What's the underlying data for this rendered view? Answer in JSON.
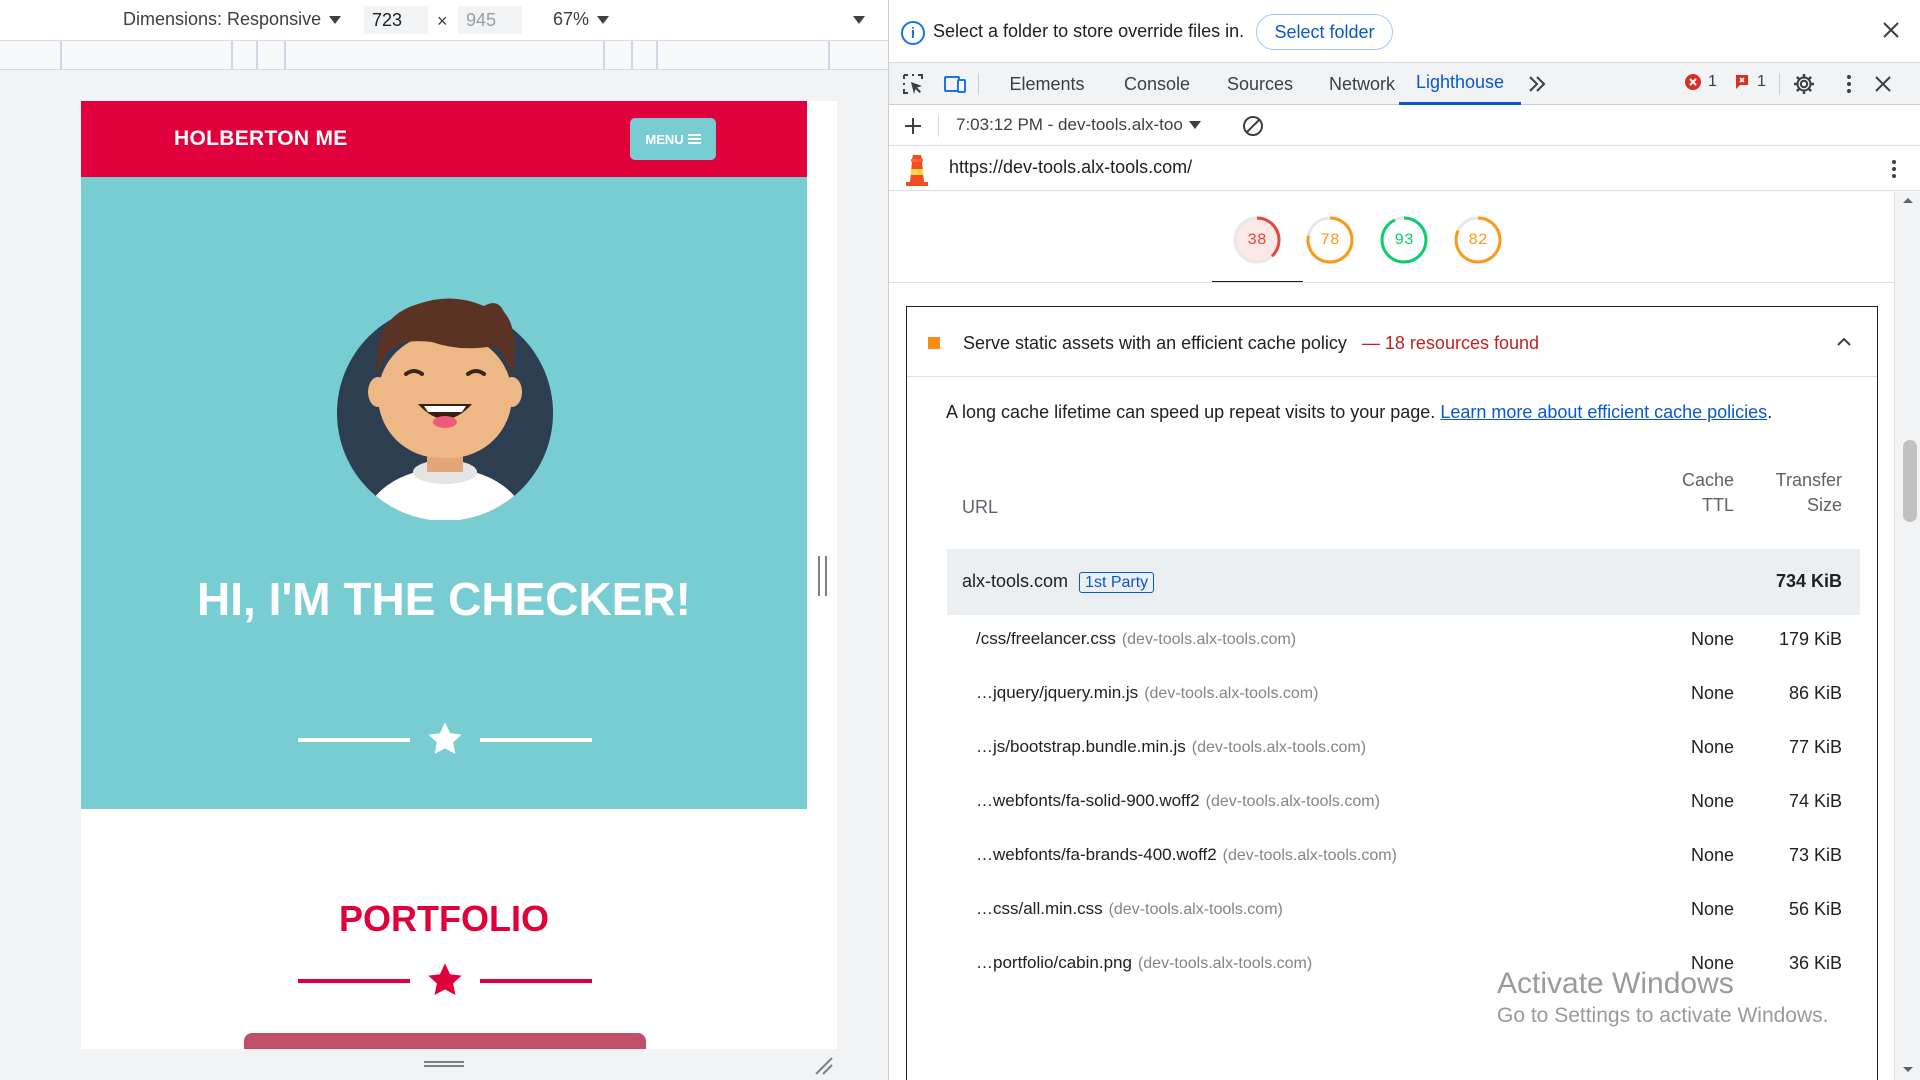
{
  "device_toolbar": {
    "dimensions_label": "Dimensions: Responsive",
    "width": "723",
    "times": "×",
    "height": "945",
    "zoom": "67%"
  },
  "site": {
    "brand": "HOLBERTON ME",
    "menu_label": "MENU",
    "hero_title": "HI, I'M THE CHECKER!",
    "portfolio_title": "PORTFOLIO",
    "colors": {
      "primary": "#e0003c",
      "teal": "#78cdd3"
    }
  },
  "infobar": {
    "message": "Select a folder to store override files in.",
    "button": "Select folder"
  },
  "tabs": [
    "Elements",
    "Console",
    "Sources",
    "Network",
    "Lighthouse"
  ],
  "active_tab": "Lighthouse",
  "issues": {
    "errors": "1",
    "warnings": "1"
  },
  "lighthouse": {
    "report_select": "7:03:12 PM - dev-tools.alx-too",
    "url": "https://dev-tools.alx-tools.com/",
    "scores": [
      {
        "value": 38,
        "color": "#e8453c",
        "bg": "#fce8e6"
      },
      {
        "value": 78,
        "color": "#fa9a1b",
        "bg": "#fff"
      },
      {
        "value": 93,
        "color": "#0cce6b",
        "bg": "#fff"
      },
      {
        "value": 82,
        "color": "#fa9a1b",
        "bg": "#fff"
      }
    ],
    "audit": {
      "title": "Serve static assets with an efficient cache policy",
      "dash": "—",
      "summary": "18 resources found",
      "description": "A long cache lifetime can speed up repeat visits to your page.",
      "learn_more": "Learn more about efficient cache policies",
      "period": ".",
      "table": {
        "headers": {
          "url": "URL",
          "ttl_1": "Cache",
          "ttl_2": "TTL",
          "size_1": "Transfer",
          "size_2": "Size"
        },
        "group": {
          "domain": "alx-tools.com",
          "tag": "1st Party",
          "size": "734 KiB"
        },
        "rows": [
          {
            "path": "/css/freelancer.css",
            "host": "(dev-tools.alx-tools.com)",
            "ttl": "None",
            "size": "179 KiB"
          },
          {
            "path": "…jquery/jquery.min.js",
            "host": "(dev-tools.alx-tools.com)",
            "ttl": "None",
            "size": "86 KiB"
          },
          {
            "path": "…js/bootstrap.bundle.min.js",
            "host": "(dev-tools.alx-tools.com)",
            "ttl": "None",
            "size": "77 KiB"
          },
          {
            "path": "…webfonts/fa-solid-900.woff2",
            "host": "(dev-tools.alx-tools.com)",
            "ttl": "None",
            "size": "74 KiB"
          },
          {
            "path": "…webfonts/fa-brands-400.woff2",
            "host": "(dev-tools.alx-tools.com)",
            "ttl": "None",
            "size": "73 KiB"
          },
          {
            "path": "…css/all.min.css",
            "host": "(dev-tools.alx-tools.com)",
            "ttl": "None",
            "size": "56 KiB"
          },
          {
            "path": "…portfolio/cabin.png",
            "host": "(dev-tools.alx-tools.com)",
            "ttl": "None",
            "size": "36 KiB"
          }
        ]
      }
    }
  },
  "watermark": {
    "line1": "Activate Windows",
    "line2": "Go to Settings to activate Windows."
  }
}
